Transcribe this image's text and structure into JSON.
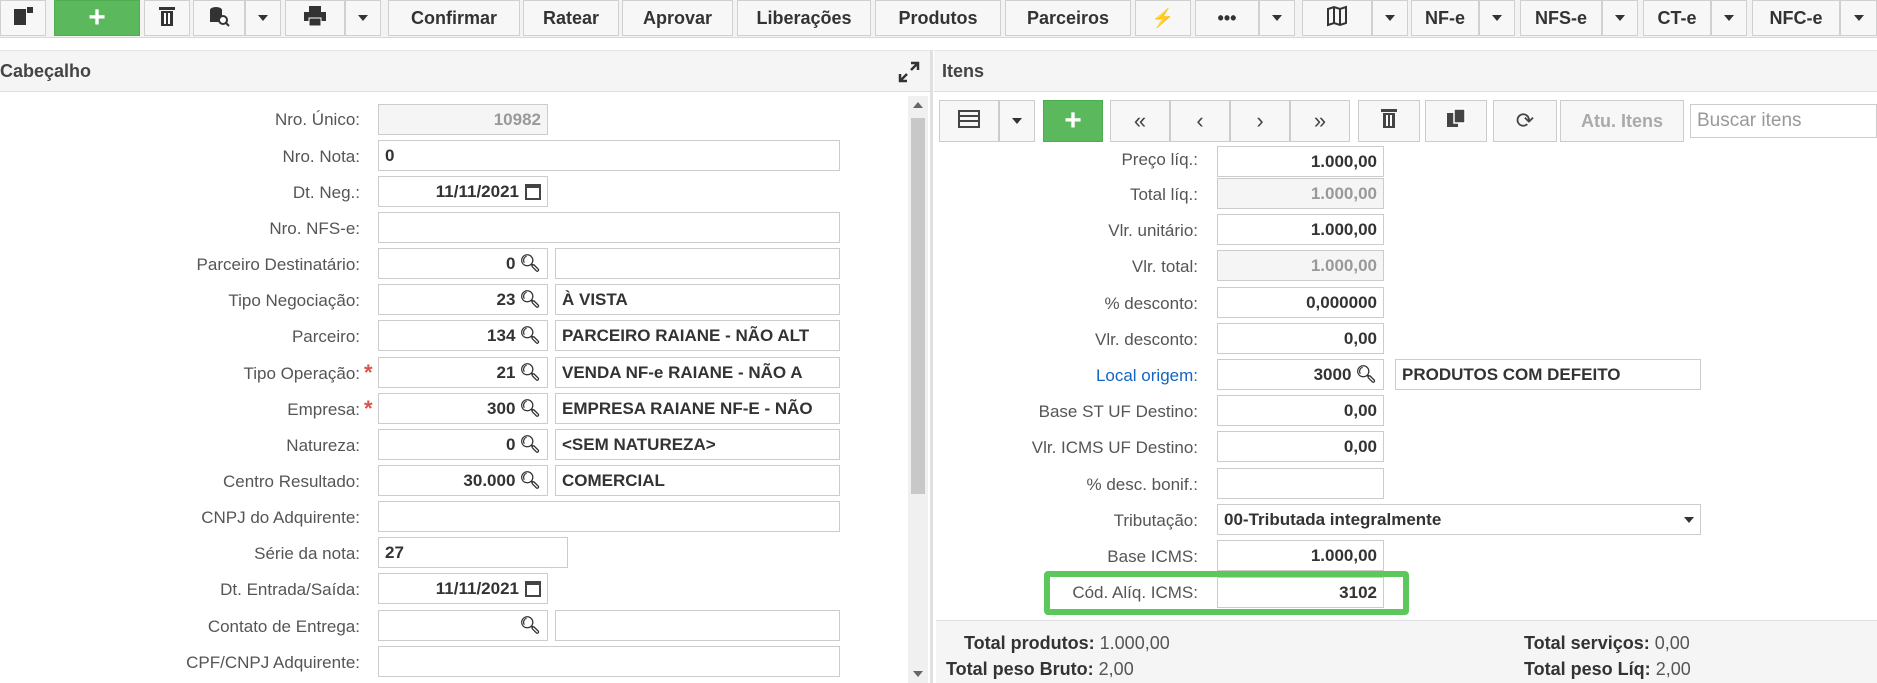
{
  "toolbar": {
    "confirmar": "Confirmar",
    "ratear": "Ratear",
    "aprovar": "Aprovar",
    "liberacoes": "Liberações",
    "produtos": "Produtos",
    "parceiros": "Parceiros",
    "more": "•••",
    "nfe": "NF-e",
    "nfse": "NFS-e",
    "cte": "CT-e",
    "nfce": "NFC-e",
    "add": "+"
  },
  "header_panel": {
    "title": "Cabeçalho"
  },
  "items_panel": {
    "title": "Itens",
    "search_placeholder": "Buscar itens",
    "atu_itens": "Atu. Itens",
    "add": "+"
  },
  "form": {
    "nro_unico": {
      "label": "Nro. Único:",
      "value": "10982"
    },
    "nro_nota": {
      "label": "Nro. Nota:",
      "value": "0"
    },
    "dt_neg": {
      "label": "Dt. Neg.:",
      "value": "11/11/2021"
    },
    "nro_nfse": {
      "label": "Nro. NFS-e:",
      "value": ""
    },
    "parceiro_dest": {
      "label": "Parceiro Destinatário:",
      "code": "0",
      "desc": ""
    },
    "tipo_neg": {
      "label": "Tipo Negociação:",
      "code": "23",
      "desc": "À VISTA"
    },
    "parceiro": {
      "label": "Parceiro:",
      "code": "134",
      "desc": "PARCEIRO RAIANE - NÃO ALT"
    },
    "tipo_oper": {
      "label": "Tipo Operação:",
      "code": "21",
      "desc": "VENDA NF-e RAIANE - NÃO A"
    },
    "empresa": {
      "label": "Empresa:",
      "code": "300",
      "desc": "EMPRESA RAIANE NF-E - NÃO"
    },
    "natureza": {
      "label": "Natureza:",
      "code": "0",
      "desc": "<SEM NATUREZA>"
    },
    "centro_res": {
      "label": "Centro Resultado:",
      "code": "30.000",
      "desc": "COMERCIAL"
    },
    "cnpj_adq": {
      "label": "CNPJ do Adquirente:",
      "value": ""
    },
    "serie": {
      "label": "Série da nota:",
      "value": "27"
    },
    "dt_entrada": {
      "label": "Dt. Entrada/Saída:",
      "value": "11/11/2021"
    },
    "contato": {
      "label": "Contato de Entrega:",
      "code": "",
      "desc": ""
    },
    "cpf_cnpj": {
      "label": "CPF/CNPJ Adquirente:",
      "value": ""
    }
  },
  "items": {
    "preco_liq": {
      "label": "Preço líq.:",
      "value": "1.000,00"
    },
    "total_liq": {
      "label": "Total líq.:",
      "value": "1.000,00"
    },
    "vlr_unit": {
      "label": "Vlr. unitário:",
      "value": "1.000,00"
    },
    "vlr_total": {
      "label": "Vlr. total:",
      "value": "1.000,00"
    },
    "pct_desc": {
      "label": "% desconto:",
      "value": "0,000000"
    },
    "vlr_desc": {
      "label": "Vlr. desconto:",
      "value": "0,00"
    },
    "local_origem": {
      "label": "Local origem:",
      "code": "3000",
      "desc": "PRODUTOS COM DEFEITO"
    },
    "base_st": {
      "label": "Base ST UF Destino:",
      "value": "0,00"
    },
    "vlr_icms_uf": {
      "label": "Vlr. ICMS UF Destino:",
      "value": "0,00"
    },
    "pct_bonif": {
      "label": "% desc. bonif.:",
      "value": ""
    },
    "tributacao": {
      "label": "Tributação:",
      "value": "00-Tributada integralmente"
    },
    "base_icms": {
      "label": "Base ICMS:",
      "value": "1.000,00"
    },
    "cod_aliq": {
      "label": "Cód. Alíq. ICMS:",
      "value": "3102"
    }
  },
  "totals": {
    "total_produtos_label": "Total produtos:",
    "total_produtos": "1.000,00",
    "total_peso_bruto_label": "Total peso Bruto:",
    "total_peso_bruto": "2,00",
    "total_servicos_label": "Total serviços:",
    "total_servicos": "0,00",
    "total_peso_liq_label": "Total peso Líq:",
    "total_peso_liq": "2,00"
  }
}
